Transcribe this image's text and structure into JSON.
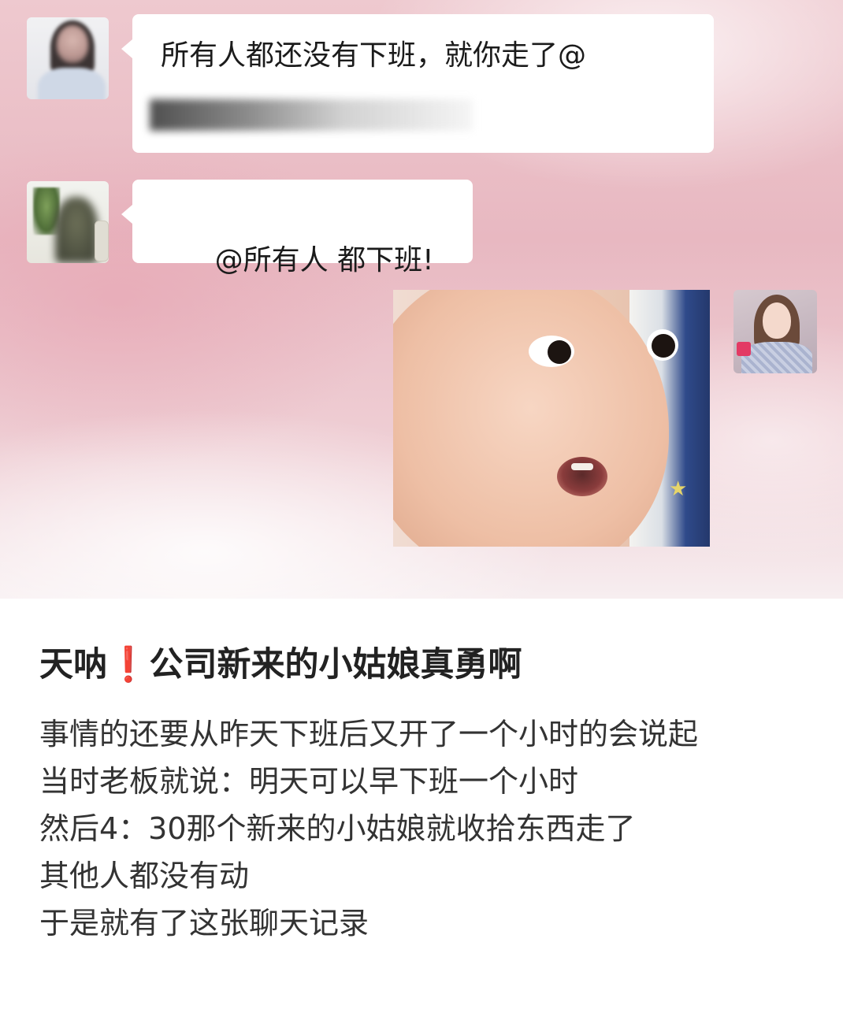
{
  "chat": {
    "messages": [
      {
        "side": "left",
        "type": "text",
        "avatar_icon": "user-avatar-blurred-woman",
        "text": "所有人都还没有下班，就你走了@"
      },
      {
        "side": "left",
        "type": "text",
        "avatar_icon": "user-avatar-blurred-plant",
        "text": "@所有人 都下班!"
      },
      {
        "side": "right",
        "type": "sticker",
        "avatar_icon": "user-avatar-woman",
        "sticker_icon": "surprised-baby-sticker"
      }
    ],
    "colors": {
      "background": "#e8b8c1",
      "bubble": "#ffffff"
    }
  },
  "post": {
    "title": "天呐",
    "title_emoji": "❗",
    "title_rest": "公司新来的小姑娘真勇啊",
    "title_emoji_color": "#e53935",
    "lines": [
      "事情的还要从昨天下班后又开了一个小时的会说起",
      "当时老板就说：明天可以早下班一个小时",
      "然后4：30那个新来的小姑娘就收拾东西走了",
      "其他人都没有动",
      "于是就有了这张聊天记录"
    ]
  }
}
